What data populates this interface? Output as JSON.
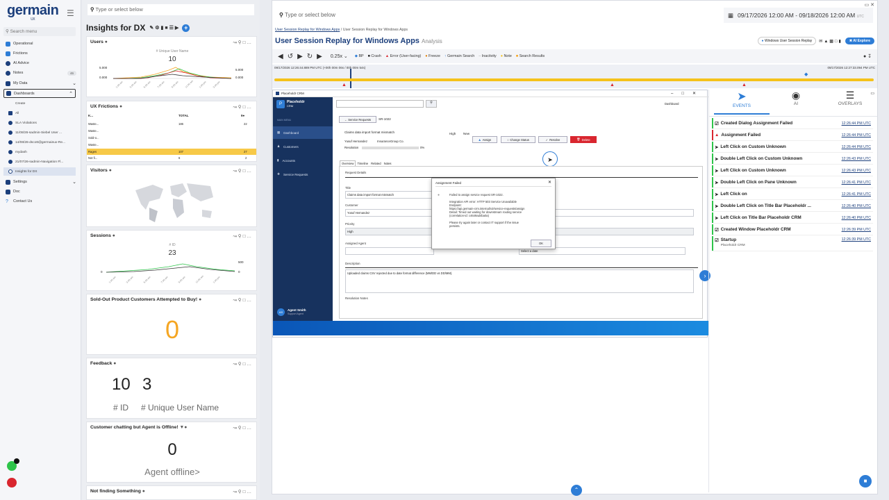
{
  "nav": {
    "logo": "germain",
    "logo_sub": "UX",
    "search_placeholder": "Search menu",
    "items": [
      {
        "label": "Operational",
        "icon": "tree-icon"
      },
      {
        "label": "Frictions",
        "icon": "friction-icon"
      },
      {
        "label": "AI Advice",
        "icon": "ai-icon"
      },
      {
        "label": "Notes",
        "icon": "notes-icon",
        "badge": "46"
      },
      {
        "label": "My Data",
        "icon": "data-icon"
      },
      {
        "label": "Dashboards",
        "icon": "dashboard-icon"
      }
    ],
    "sub_items": [
      {
        "label": "Create"
      },
      {
        "label": "All"
      },
      {
        "label": "SLA Violations"
      },
      {
        "label": "11/08/26-sadmin-Siebel User ..."
      },
      {
        "label": "14/08/26-dscott@germainux-Re..."
      },
      {
        "label": "mydash"
      },
      {
        "label": "21/07/26-sadmin-Navigation Fl..."
      },
      {
        "label": "Insights for DX"
      }
    ],
    "bottom_items": [
      {
        "label": "Settings"
      },
      {
        "label": "Doc"
      },
      {
        "label": "Contact Us"
      }
    ]
  },
  "widgets": {
    "search_placeholder": "Type or select below",
    "dashboard_title": "Insights for DX",
    "users": {
      "title": "Users",
      "metric_label": "# Unique User Name",
      "metric_value": "10",
      "axis_top": "5.000",
      "axis_bottom": "0.000"
    },
    "ux_frictions": {
      "title": "UX Frictions",
      "col_k": "K...",
      "col_total": "TOTAL",
      "col_right": "9●",
      "rows": [
        {
          "k": "Waste...",
          "total": "186",
          "v": "22"
        },
        {
          "k": "Waste...",
          "total": "",
          "v": ""
        },
        {
          "k": "Sold-o...",
          "total": "",
          "v": ""
        },
        {
          "k": "Waste...",
          "total": "",
          "v": ""
        },
        {
          "k": "Rages",
          "total": "107",
          "v": "27"
        },
        {
          "k": "Not fi...",
          "total": "6",
          "v": "2"
        }
      ]
    },
    "visitors": {
      "title": "Visitors"
    },
    "sessions": {
      "title": "Sessions",
      "metric_label": "# ID",
      "metric_value": "23",
      "axis_top": "500",
      "axis_bottom": "0"
    },
    "soldout": {
      "title": "Sold-Out Product Customers Attempted to Buy!",
      "value": "0"
    },
    "feedback": {
      "title": "Feedback",
      "id_value": "10",
      "user_value": "3",
      "id_label": "# ID",
      "user_label": "# Unique User Name"
    },
    "chatting": {
      "title": "Customer chatting but Agent is Offline!",
      "value": "0",
      "label": "Agent offline>"
    },
    "not_finding": {
      "title": "Not finding Something"
    }
  },
  "main": {
    "search_placeholder": "Type or select below",
    "date_range": "09/17/2026 12:00 AM - 09/18/2026 12:00 AM",
    "tz": "UTC",
    "breadcrumb_link": "User Session Replay for Windows Apps",
    "breadcrumb_current": "User Session Replay for Windows Apps",
    "title": "User Session Replay for Windows Apps",
    "title_sub": "Analysis",
    "replay_chip": "Windows User Session Replay",
    "ai_explore": "AI Explore",
    "speed": "0.25x",
    "toolbar_items": [
      "BP",
      "Crash",
      "Error (User-facing)",
      "Freeze",
      "Germain Search",
      "Inactivity",
      "Note",
      "Search Results"
    ],
    "timeline_start": "09/17/2026 12:26:44.889 PM UTC (+00h 00m 06s / 00h 00m 54s)",
    "timeline_end": "09/17/2026 12:27:33.094 PM UTC"
  },
  "crm": {
    "window_title": "Placeholdr CRM",
    "app_name": "Placeholdr",
    "app_sub": "CRM",
    "menu_header": "MAIN MENU",
    "nav": [
      "Dashboard",
      "Customers",
      "Accounts",
      "Service Requests"
    ],
    "top_link": "Dashboard",
    "back_button": "← Service Requests",
    "sr_id": "SR-1022",
    "summary": "Claims data import format mismatch",
    "priority_value": "High",
    "status_value": "New",
    "customer_name": "Yusuf Hernandez",
    "company": "InsuranceGroup Co.",
    "resolution_label": "Resolution",
    "resolution_pct": "0%",
    "actions": [
      "Assign",
      "Change Status",
      "Resolve",
      "Delete"
    ],
    "tabs": [
      "Overview",
      "Timeline",
      "Related",
      "Notes"
    ],
    "section": "Request Details",
    "title_label": "Title",
    "title_value": "Claims data import format mismatch",
    "customer_label": "Customer",
    "customer_value": "Yusuf Hernandez",
    "priority_label": "Priority",
    "agent_label": "Assigned Agent",
    "date_placeholder": "Select a date",
    "description_label": "Description",
    "description_value": "Uploaded claims CSV rejected due to date format difference (MM/DD vs DD/MM).",
    "resolution_notes": "Resolution Notes",
    "user_initials": "AS",
    "user_name": "Agent Smith",
    "user_role": "Support Agent"
  },
  "dialog": {
    "title": "Assignment Failed",
    "line1": "Failed to assign service request SR-1022.",
    "line2": "Integration API error: HTTP 503 Service Unavailable",
    "line3": "Endpoint:",
    "line4": "https://api.germain-crm.internal/v2/service-requests/assign",
    "line5": "Detail: Timed out waiting for downstream routing service",
    "line6": "(correlation-id: c4649ad4ba0a)",
    "line7": "Please try again later or contact IT support if the issue",
    "line8": "persists.",
    "ok": "OK"
  },
  "events": {
    "tabs": [
      "EVENTS",
      "AI",
      "OVERLAYS"
    ],
    "rows": [
      {
        "label": "Created Dialog Assignment Failed",
        "time": "12:26:44 PM UTC",
        "icon": "window-icon"
      },
      {
        "label": "Assignment Failed",
        "time": "12:26:44 PM UTC",
        "icon": "error-icon"
      },
      {
        "label": "Left Click on Custom Unknown",
        "time": "12:26:44 PM UTC",
        "icon": "cursor-icon"
      },
      {
        "label": "Double Left Click on Custom Unknown",
        "time": "12:26:43 PM UTC",
        "icon": "cursor-icon"
      },
      {
        "label": "Left Click on Custom Unknown",
        "time": "12:26:43 PM UTC",
        "icon": "cursor-icon"
      },
      {
        "label": "Double Left Click on Pane Unknown",
        "time": "12:26:41 PM UTC",
        "icon": "cursor-icon"
      },
      {
        "label": "Left Click on",
        "time": "12:26:41 PM UTC",
        "icon": "cursor-icon"
      },
      {
        "label": "Double Left Click on Title Bar Placeholdr ...",
        "time": "12:26:40 PM UTC",
        "icon": "cursor-icon"
      },
      {
        "label": "Left Click on Title Bar Placeholdr CRM",
        "time": "12:26:40 PM UTC",
        "icon": "cursor-icon"
      },
      {
        "label": "Created Window Placeholdr CRM",
        "time": "12:26:39 PM UTC",
        "icon": "window-icon"
      },
      {
        "label": "Startup",
        "time": "12:26:39 PM UTC",
        "icon": "window-icon",
        "sub": "Placeholdr CRM"
      }
    ]
  },
  "colors": {
    "brand": "#1c3f7c",
    "accent": "#f5a623",
    "timeline": "#f5c21b",
    "danger": "#d9262f",
    "success": "#2ec44a"
  }
}
